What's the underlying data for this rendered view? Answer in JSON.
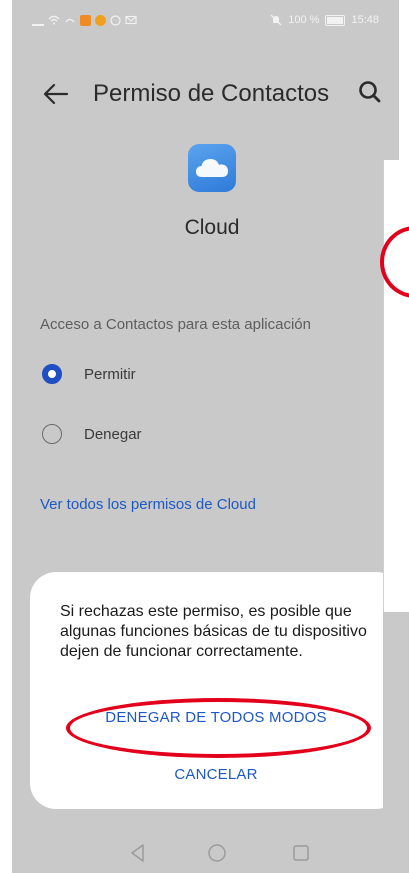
{
  "statusbar": {
    "left_icons": [
      "signal-icon",
      "wifi-icon",
      "sync-icon",
      "app-badge-icon",
      "app-badge-icon-2",
      "circle-icon",
      "mail-icon"
    ],
    "mute_icon": "mute-icon",
    "battery_text": "100 %",
    "time": "15:48"
  },
  "header": {
    "title": "Permiso de Contactos",
    "back_icon": "back-arrow-icon",
    "search_icon": "search-icon"
  },
  "app": {
    "name": "Cloud",
    "icon": "cloud-icon",
    "icon_color": "#2f7ad8"
  },
  "permission": {
    "section_label": "Acceso a Contactos para esta aplicación",
    "options": [
      {
        "label": "Permitir",
        "selected": true
      },
      {
        "label": "Denegar",
        "selected": false
      }
    ],
    "link": "Ver todos los permisos de Cloud"
  },
  "dialog": {
    "message": "Si rechazas este permiso, es posible que algunas funciones básicas de tu dispositivo dejen de funcionar correctamente.",
    "deny_label": "DENEGAR DE TODOS MODOS",
    "cancel_label": "CANCELAR"
  },
  "navbar": {
    "back": "nav-back-icon",
    "home": "nav-home-icon",
    "recent": "nav-recent-icon"
  },
  "colors": {
    "accent": "#1e58c6",
    "radio_selected": "#1f4fc2",
    "overlay": "#c9c9c9",
    "annotation": "#e3001b"
  }
}
